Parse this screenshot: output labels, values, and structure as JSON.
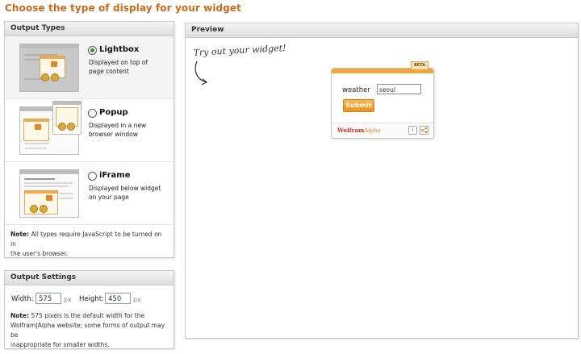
{
  "page": {
    "title": "Choose the type of display for your widget"
  },
  "output_types": {
    "header": "Output Types",
    "options": [
      {
        "title": "Lightbox",
        "desc_line1": "Displayed on top of",
        "desc_line2": "page content",
        "selected": true
      },
      {
        "title": "Popup",
        "desc_line1": "Displayed in a new",
        "desc_line2": "browser window",
        "selected": false
      },
      {
        "title": "iFrame",
        "desc_line1": "Displayed below widget",
        "desc_line2": "on your page",
        "selected": false
      }
    ],
    "note_label": "Note:",
    "note_text1": " All types require JavaScript to be turned on in",
    "note_text2": "the user's browser."
  },
  "output_settings": {
    "header": "Output Settings",
    "width_label": "Width:",
    "width_value": "575",
    "height_label": "Height:",
    "height_value": "450",
    "unit": "px",
    "note_label": "Note:",
    "note_text1": " 575 pixels is the default width for the",
    "note_text2": "Wolfram|Alpha website; some forms of output may be",
    "note_text3": "inappropriate for smaller widths."
  },
  "preview": {
    "header": "Preview",
    "try_text": "Try out your widget!",
    "widget": {
      "beta": "BETA",
      "field_label": "weather",
      "field_value": "seoul",
      "submit_label": "Submit",
      "brand_main": "Wolfram",
      "brand_accent": "Alpha",
      "info_icon": "i"
    }
  },
  "colors": {
    "title": "#c96a1b",
    "accent": "#f1a53d"
  }
}
